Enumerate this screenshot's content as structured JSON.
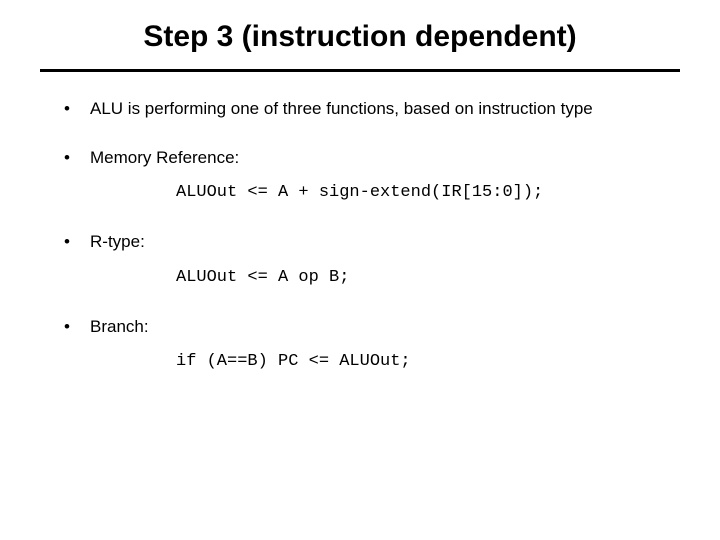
{
  "title": "Step 3 (instruction dependent)",
  "bullets": [
    {
      "text": "ALU is performing one of three functions, based on instruction type",
      "code": null
    },
    {
      "text": "Memory Reference:",
      "code": "ALUOut <= A + sign-extend(IR[15:0]);"
    },
    {
      "text": "R-type:",
      "code": "ALUOut <= A op B;"
    },
    {
      "text": "Branch:",
      "code": "if (A==B) PC <= ALUOut;"
    }
  ]
}
